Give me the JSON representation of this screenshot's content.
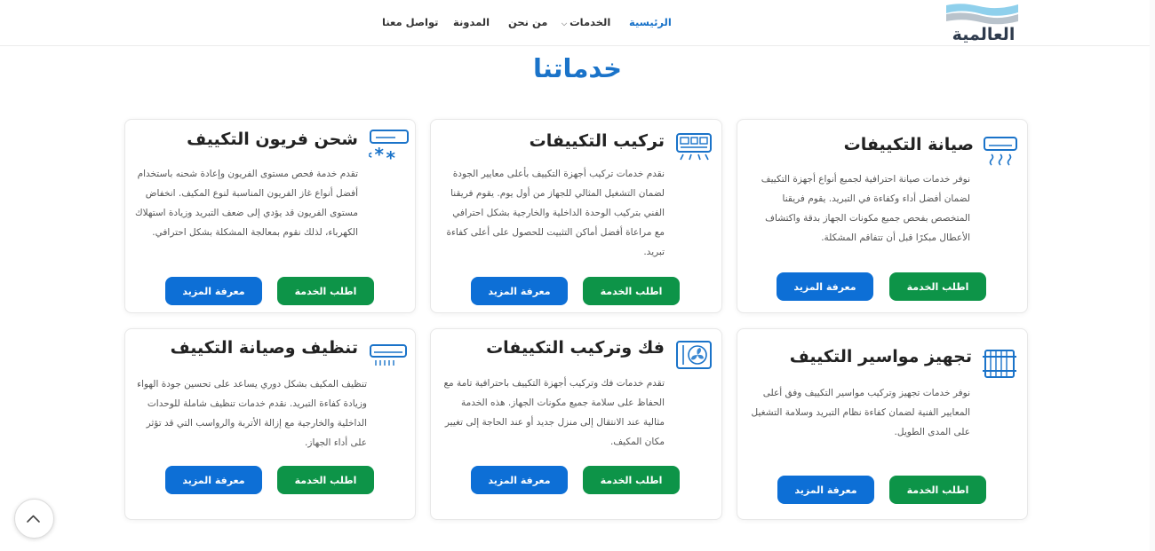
{
  "header": {
    "logo_text": "العالمية",
    "nav": [
      {
        "label": "الرئيسية"
      },
      {
        "label": "الخدمات"
      },
      {
        "label": "من نحن"
      },
      {
        "label": "المدونة"
      },
      {
        "label": "تواصل معنا"
      }
    ]
  },
  "section_title": "خدماتنا",
  "buttons": {
    "request": "اطلب الخدمة",
    "more": "معرفة المزيد"
  },
  "cards": [
    {
      "title": "صيانة التكييفات",
      "icon": "ac-unit-icon",
      "description": "نوفر خدمات صيانة احترافية لجميع أنواع أجهزة التكييف لضمان أفضل أداء وكفاءة في التبريد. يقوم فريقنا المتخصص بفحص جميع مكونات الجهاز بدقة واكتشاف الأعطال مبكرًا قبل أن تتفاقم المشكلة."
    },
    {
      "title": "تركيب التكييفات",
      "icon": "installation-icon",
      "description": "نقدم خدمات تركيب أجهزة التكييف بأعلى معايير الجودة لضمان التشغيل المثالي للجهاز من أول يوم. يقوم فريقنا الفني بتركيب الوحدة الداخلية والخارجية بشكل احترافي مع مراعاة أفضل أماكن التثبيت للحصول على أعلى كفاءة تبريد."
    },
    {
      "title": "شحن فريون التكييف",
      "icon": "snowflake-ac-icon",
      "description": "تقدم خدمة فحص مستوى الفريون وإعادة شحنه باستخدام أفضل أنواع غاز الفريون المناسبة لنوع المكيف. انخفاض مستوى الفريون قد يؤدي إلى ضعف التبريد وزيادة استهلاك الكهرباء، لذلك نقوم بمعالجة المشكلة بشكل احترافي."
    },
    {
      "title": "تجهيز مواسير التكييف",
      "icon": "pipes-icon",
      "description": "نوفر خدمات تجهيز وتركيب مواسير التكييف وفق أعلى المعايير الفنية لضمان كفاءة نظام التبريد وسلامة التشغيل على المدى الطويل."
    },
    {
      "title": "فك وتركيب التكييفات",
      "icon": "fan-unit-icon",
      "description": "تقدم خدمات فك وتركيب أجهزة التكييف باحترافية تامة مع الحفاظ على سلامة جميع مكونات الجهاز. هذه الخدمة مثالية عند الانتقال إلى منزل جديد أو عند الحاجة إلى تغيير مكان المكيف."
    },
    {
      "title": "تنظيف وصيانة التكييف",
      "icon": "cleaning-ac-icon",
      "description": "تنظيف المكيف بشكل دوري يساعد على تحسين جودة الهواء وزيادة كفاءة التبريد. نقدم خدمات تنظيف شاملة للوحدات الداخلية والخارجية مع إزالة الأتربة والرواسب التي قد تؤثر على أداء الجهاز."
    }
  ],
  "colors": {
    "primary": "#1a73c9",
    "green": "#0d9448",
    "blue": "#0d6fd6"
  }
}
